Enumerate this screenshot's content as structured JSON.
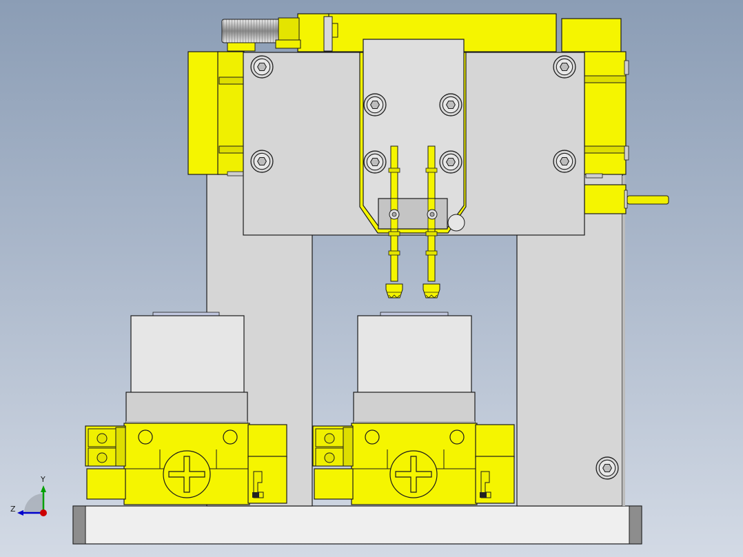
{
  "viewport": {
    "background_top": "#8b9db5",
    "background_bottom": "#d3dae5"
  },
  "colors": {
    "part_yellow": "#f5f500",
    "part_yellow_dark": "#d8d800",
    "plate_gray": "#d6d6d6",
    "plate_gray_light": "#e6e6e6",
    "base_white": "#efefef",
    "outline": "#1a1a1a",
    "axis_x": "#cc0000",
    "axis_y": "#00a000",
    "axis_z": "#0000cc"
  },
  "triad": {
    "y_label": "Y",
    "z_label": "Z"
  },
  "icons": {
    "triad": "coordinate-triad-icon",
    "screw": "hex-socket-screw-icon",
    "cross": "cross-slot-icon"
  }
}
